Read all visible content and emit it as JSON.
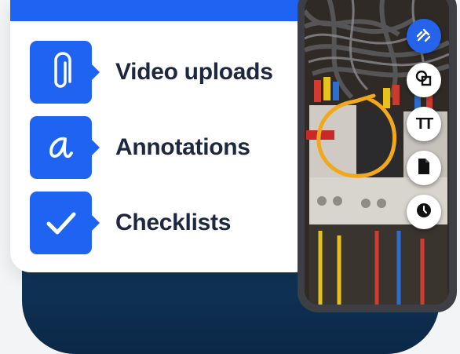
{
  "features": [
    {
      "label": "Video uploads",
      "icon": "paperclip-icon"
    },
    {
      "label": "Annotations",
      "icon": "handwriting-a-icon"
    },
    {
      "label": "Checklists",
      "icon": "checkmark-icon"
    }
  ],
  "toolbar": {
    "tools": [
      {
        "name": "draw-tool",
        "icon": "pen-icon",
        "active": true
      },
      {
        "name": "shapes-tool",
        "icon": "shapes-icon",
        "active": false
      },
      {
        "name": "text-tool",
        "icon": "text-size-icon",
        "label": "TT",
        "active": false
      },
      {
        "name": "document-tool",
        "icon": "document-icon",
        "active": false
      },
      {
        "name": "clock-tool",
        "icon": "clock-icon",
        "active": false
      }
    ]
  },
  "colors": {
    "accent": "#1f63f2",
    "label_text": "#1d2740",
    "annotation_circle": "#f2a81d",
    "dark_panel": "#0f3153"
  }
}
